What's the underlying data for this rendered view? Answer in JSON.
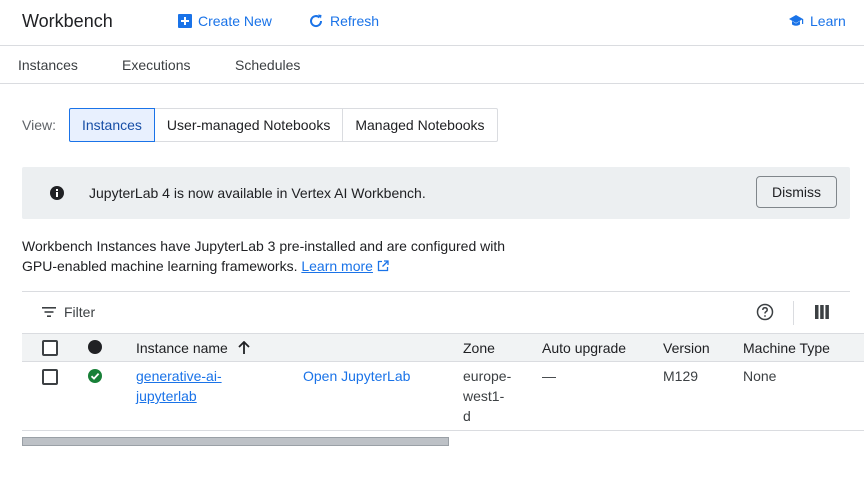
{
  "header": {
    "title": "Workbench",
    "create_label": "Create New",
    "refresh_label": "Refresh",
    "learn_label": "Learn"
  },
  "tabs": [
    "Instances",
    "Executions",
    "Schedules"
  ],
  "view": {
    "label": "View:",
    "options": [
      "Instances",
      "User-managed Notebooks",
      "Managed Notebooks"
    ],
    "selected": "Instances"
  },
  "banner": {
    "text": "JupyterLab 4 is now available in Vertex AI Workbench.",
    "dismiss_label": "Dismiss"
  },
  "description": {
    "line1": "Workbench Instances have JupyterLab 3 pre-installed and are configured with",
    "line2": "GPU-enabled machine learning frameworks.",
    "link": "Learn more"
  },
  "filter": {
    "label": "Filter"
  },
  "table": {
    "columns": [
      "Instance name",
      "Zone",
      "Auto upgrade",
      "Version",
      "Machine Type"
    ],
    "rows": [
      {
        "name_line1": "generative-ai-",
        "name_line2": "jupyterlab",
        "action": "Open JupyterLab",
        "zone_line1": "europe-",
        "zone_line2": "west1-",
        "zone_line3": "d",
        "auto_upgrade": "—",
        "version": "M129",
        "machine_type": "None"
      }
    ]
  },
  "colors": {
    "accent": "#1a73e8",
    "status_ok": "#188038",
    "banner_bg": "#eceff1"
  }
}
